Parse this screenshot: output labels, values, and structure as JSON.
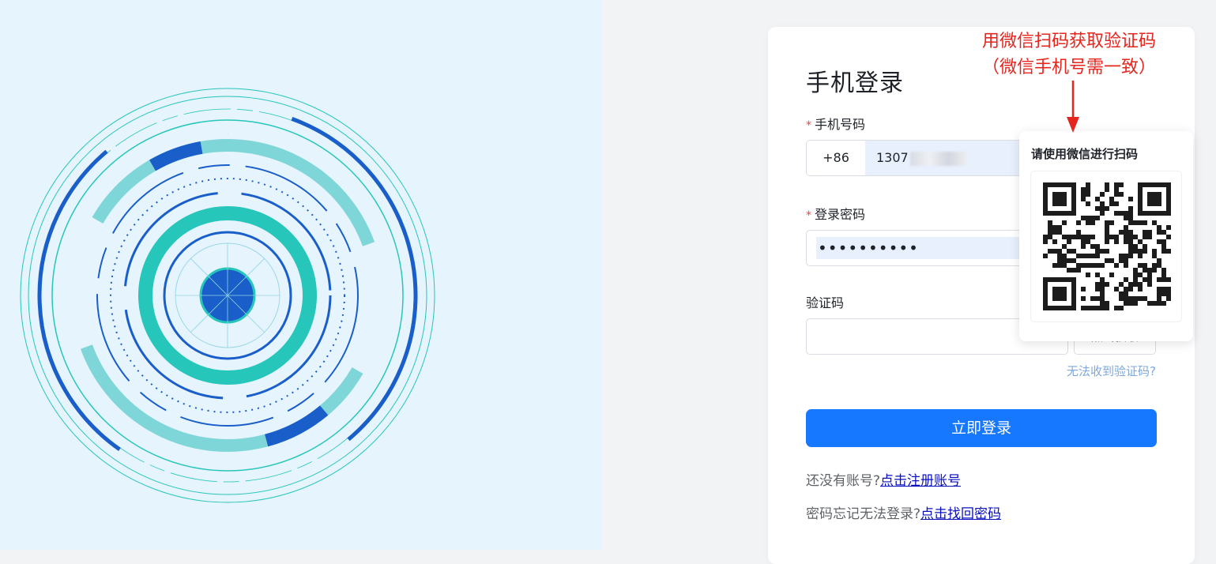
{
  "colors": {
    "left_bg": "#e6f4fd",
    "primary": "#1677ff",
    "required_mark": "#f53f3f",
    "annotation": "#e5261f",
    "link": "#0a0fbd",
    "help_link": "#7fa8dc",
    "autofill": "#e8f0fe"
  },
  "illustration": {
    "icon": "tech-circle-illustration"
  },
  "login": {
    "title": "手机登录",
    "phone_label": "手机号码",
    "phone_prefix": "+86",
    "phone_value": "1307",
    "password_label": "登录密码",
    "password_value": "••••••••••",
    "code_label": "验证码",
    "code_button": "点击获取",
    "code_help": "无法收到验证码?",
    "submit": "立即登录",
    "no_account_text": "还没有账号?",
    "register_link": "点击注册账号",
    "forgot_text": "密码忘记无法登录?",
    "recover_link": "点击找回密码",
    "required_mark": "*"
  },
  "qr_popup": {
    "title": "请使用微信进行扫码",
    "icon": "qr-code-icon"
  },
  "annotation": {
    "line1": "用微信扫码获取验证码",
    "line2": "（微信手机号需一致）",
    "icon": "arrow-down-icon"
  }
}
